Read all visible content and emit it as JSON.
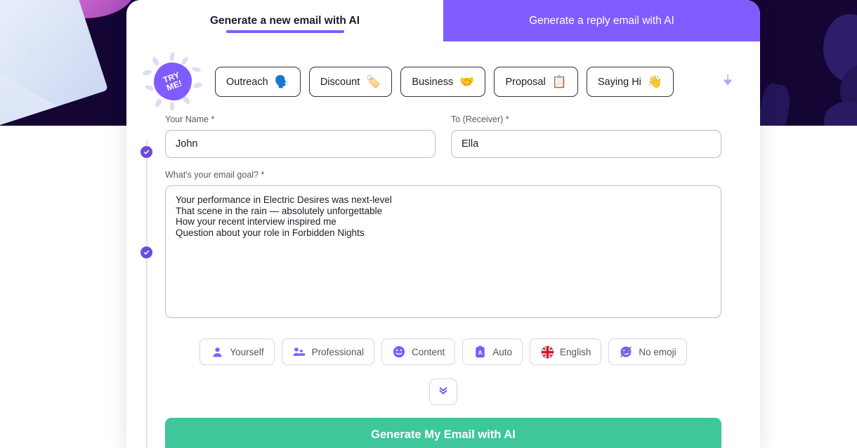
{
  "tabs": [
    {
      "label": "Generate a new email with AI",
      "state": "active"
    },
    {
      "label": "Generate a reply email with AI",
      "state": "inactive"
    }
  ],
  "badge": {
    "line1": "TRY",
    "line2": "ME!"
  },
  "category_chips": [
    {
      "label": "Outreach",
      "emoji": "🗣️",
      "icon_name": "speaking-head-emoji"
    },
    {
      "label": "Discount",
      "emoji": "🏷️",
      "icon_name": "label-tag-emoji"
    },
    {
      "label": "Business",
      "emoji": "🤝",
      "icon_name": "handshake-emoji"
    },
    {
      "label": "Proposal",
      "emoji": "📋",
      "icon_name": "clipboard-emoji"
    },
    {
      "label": "Saying Hi",
      "emoji": "👋",
      "icon_name": "waving-hand-emoji"
    }
  ],
  "chip_caret_icon": "chevron-down-icon",
  "form": {
    "name": {
      "label": "Your Name *",
      "value": "John",
      "placeholder": "Your Name"
    },
    "receiver": {
      "label": "To (Receiver) *",
      "value": "Ella",
      "placeholder": "To (Receiver)"
    },
    "goal": {
      "label": "What's your email goal? *",
      "value": "Your performance in Electric Desires was next-level\nThat scene in the rain — absolutely unforgettable\nHow your recent interview inspired me\nQuestion about your role in Forbidden Nights",
      "placeholder": "What's your email goal?"
    }
  },
  "options": [
    {
      "label": "Yourself",
      "icon_name": "person-icon"
    },
    {
      "label": "Professional",
      "icon_name": "people-group-icon"
    },
    {
      "label": "Content",
      "icon_name": "smiley-face-icon"
    },
    {
      "label": "Auto",
      "icon_name": "auto-length-icon"
    },
    {
      "label": "English",
      "icon_name": "uk-flag-icon"
    },
    {
      "label": "No emoji",
      "icon_name": "no-emoji-icon"
    }
  ],
  "expand_button": {
    "icon_name": "double-chevron-down-icon"
  },
  "cta": {
    "label": "Generate My Email with AI"
  },
  "colors": {
    "accent_purple": "#7f5cff",
    "rail_purple": "#6c4bdb",
    "cta_green": "#3fc69a",
    "background_dark": "#150534"
  }
}
